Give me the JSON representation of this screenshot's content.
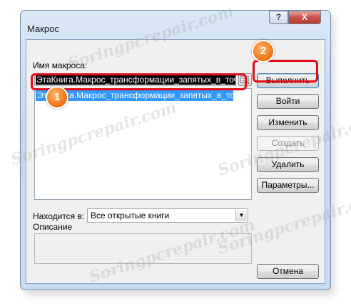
{
  "window": {
    "title": "Макрос",
    "help_label": "?",
    "close_label": "X"
  },
  "macro_name": {
    "label": "Имя макроса:",
    "value": "ЭтаКнига.Макрос_трансформации_запятых_в_точки"
  },
  "macro_list": {
    "items": [
      "ЭтаКнига.Макрос_трансформации_запятых_в_точки"
    ]
  },
  "buttons": {
    "run": "Выполнить",
    "step_into": "Войти",
    "edit": "Изменить",
    "create": "Создать",
    "delete": "Удалить",
    "options": "Параметры...",
    "cancel": "Отмена"
  },
  "location": {
    "label": "Находится в:",
    "selected": "Все открытые книги"
  },
  "description": {
    "label": "Описание"
  },
  "annotations": {
    "badge1": "1",
    "badge2": "2",
    "highlight_color": "#e30d16",
    "badge_color": "#f07a1a"
  },
  "watermark": "Soringpcrepair.com"
}
